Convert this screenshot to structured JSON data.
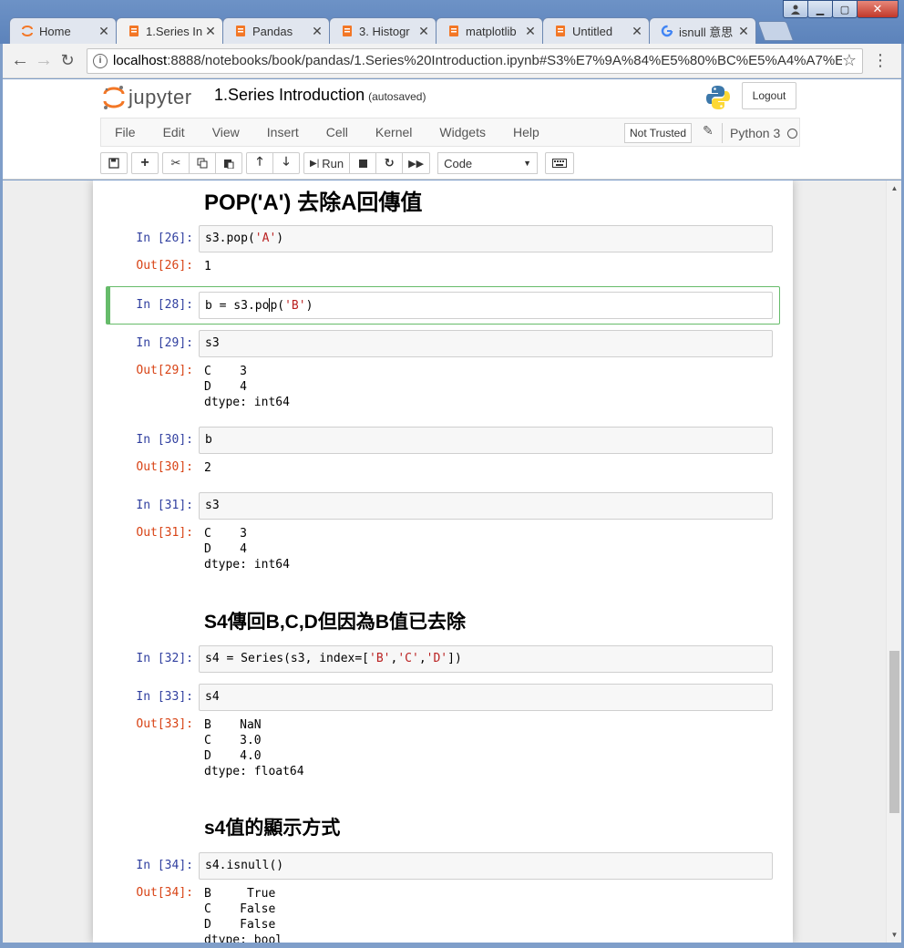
{
  "browser": {
    "tabs": [
      {
        "label": "Home",
        "icon": "jupyter-icon",
        "active": false
      },
      {
        "label": "1.Series In",
        "icon": "notebook-icon",
        "active": true
      },
      {
        "label": "Pandas",
        "icon": "notebook-icon",
        "active": false
      },
      {
        "label": "3. Histogr",
        "icon": "notebook-icon",
        "active": false
      },
      {
        "label": "matplotlib",
        "icon": "notebook-icon",
        "active": false
      },
      {
        "label": "Untitled",
        "icon": "notebook-icon",
        "active": false
      },
      {
        "label": "isnull 意思",
        "icon": "google-icon",
        "active": false
      }
    ],
    "url_host": "localhost",
    "url_rest": ":8888/notebooks/book/pandas/1.Series%20Introduction.ipynb#S3%E7%9A%84%E5%80%BC%E5%A4%A7%E..."
  },
  "jupyter": {
    "logo_text": "jupyter",
    "notebook_name": "1.Series Introduction",
    "save_status": "(autosaved)",
    "logout_label": "Logout",
    "menu": [
      "File",
      "Edit",
      "View",
      "Insert",
      "Cell",
      "Kernel",
      "Widgets",
      "Help"
    ],
    "trust_label": "Not Trusted",
    "kernel_name": "Python 3",
    "run_label": "Run",
    "cell_type": "Code"
  },
  "notebook": {
    "headings": {
      "h1": "POP('A') 去除A回傳值",
      "h2": "S4傳回B,C,D但因為B值已去除",
      "h3": "s4值的顯示方式"
    },
    "cells": {
      "c26": {
        "in": "In [26]:",
        "code_pre": "s3.pop(",
        "code_str": "'A'",
        "code_post": ")",
        "out": "Out[26]:",
        "result": "1"
      },
      "c28": {
        "in": "In [28]:",
        "code_pre": "b = s3.po",
        "code_mid": "p(",
        "code_str": "'B'",
        "code_post": ")"
      },
      "c29": {
        "in": "In [29]:",
        "code": "s3",
        "out": "Out[29]:",
        "result": "C    3\nD    4\ndtype: int64"
      },
      "c30": {
        "in": "In [30]:",
        "code": "b",
        "out": "Out[30]:",
        "result": "2"
      },
      "c31": {
        "in": "In [31]:",
        "code": "s3",
        "out": "Out[31]:",
        "result": "C    3\nD    4\ndtype: int64"
      },
      "c32": {
        "in": "In [32]:",
        "code_pre": "s4 = Series(s3, index=[",
        "s1": "'B'",
        "s2": "'C'",
        "s3": "'D'",
        "code_post": "])"
      },
      "c33": {
        "in": "In [33]:",
        "code": "s4",
        "out": "Out[33]:",
        "result": "B    NaN\nC    3.0\nD    4.0\ndtype: float64"
      },
      "c34": {
        "in": "In [34]:",
        "code": "s4.isnull()",
        "out": "Out[34]:",
        "result": "B     True\nC    False\nD    False\ndtype: bool"
      }
    }
  },
  "colors": {
    "selected_cell_border": "#66bb6a",
    "in_prompt": "#303f9f",
    "out_prompt": "#d84315",
    "string_literal": "#ba2121"
  }
}
